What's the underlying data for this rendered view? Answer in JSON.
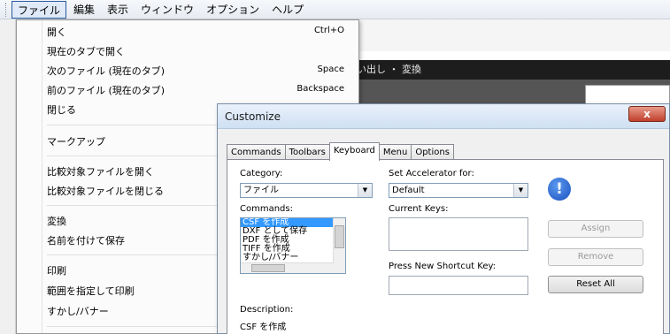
{
  "menubar": {
    "items": [
      "ファイル",
      "編集",
      "表示",
      "ウィンドウ",
      "オプション",
      "ヘルプ"
    ]
  },
  "background": {
    "toolbar_text": "ー ・ 墨消し ・ 拾い出し ・ 変換"
  },
  "file_menu": {
    "items": [
      {
        "label": "開く",
        "shortcut": "Ctrl+O"
      },
      {
        "label": "現在のタブで開く",
        "shortcut": ""
      },
      {
        "label": "次のファイル (現在のタブ)",
        "shortcut": "Space"
      },
      {
        "label": "前のファイル (現在のタブ)",
        "shortcut": "Backspace"
      },
      {
        "label": "閉じる",
        "shortcut": ""
      },
      {
        "label": "マークアップ",
        "shortcut": ""
      },
      {
        "label": "比較対象ファイルを開く",
        "shortcut": ""
      },
      {
        "label": "比較対象ファイルを閉じる",
        "shortcut": ""
      },
      {
        "label": "変換",
        "shortcut": ""
      },
      {
        "label": "名前を付けて保存",
        "shortcut": ""
      },
      {
        "label": "印刷",
        "shortcut": ""
      },
      {
        "label": "範囲を指定して印刷",
        "shortcut": ""
      },
      {
        "label": "すかし/バナー",
        "shortcut": ""
      }
    ]
  },
  "dialog": {
    "title": "Customize",
    "close_label": "x",
    "tabs": [
      "Commands",
      "Toolbars",
      "Keyboard",
      "Menu",
      "Options"
    ],
    "active_tab": "Keyboard",
    "category_label": "Category:",
    "category_value": "ファイル",
    "commands_label": "Commands:",
    "commands": [
      "CSF を作成",
      "DXF として保存",
      "PDF を作成",
      "TIFF を作成",
      "すかし/バナー"
    ],
    "selected_command": "CSF を作成",
    "set_accel_label": "Set Accelerator for:",
    "set_accel_value": "Default",
    "current_keys_label": "Current Keys:",
    "new_shortcut_label": "Press New Shortcut Key:",
    "assign_label": "Assign",
    "remove_label": "Remove",
    "reset_all_label": "Reset All",
    "description_label": "Description:",
    "description_value": "CSF を作成",
    "info_icon_glyph": "!"
  },
  "colors": {
    "selection": "#3399ff",
    "info_icon": "#1a4fbf",
    "close_button": "#c0402b"
  }
}
